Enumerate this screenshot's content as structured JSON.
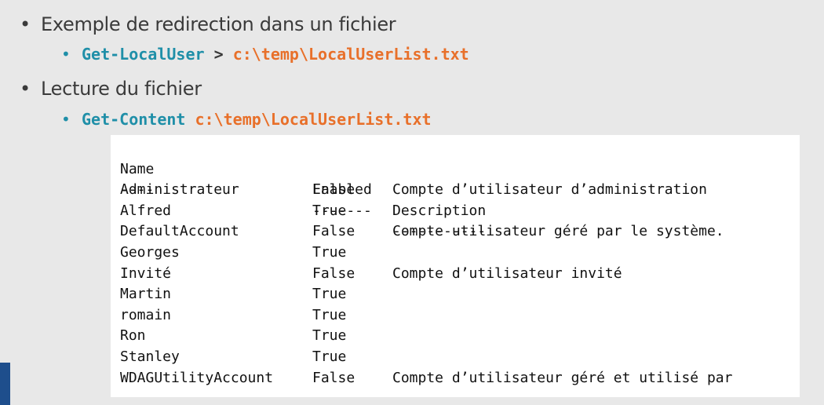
{
  "slide": {
    "bullet1": "Exemple de redirection dans un fichier",
    "cmd1": {
      "command": "Get-LocalUser",
      "operator": ">",
      "path": "c:\\temp\\LocalUserList.txt"
    },
    "bullet2": "Lecture du fichier",
    "cmd2": {
      "command": "Get-Content",
      "path": "c:\\temp\\LocalUserList.txt"
    }
  },
  "console": {
    "headers": [
      "Name",
      "Enabled",
      "Description"
    ],
    "separators": [
      "----",
      "-------",
      "-----------"
    ],
    "rows": [
      {
        "name": "Administrateur",
        "enabled": "False",
        "description": "Compte d’utilisateur d’administration"
      },
      {
        "name": "Alfred",
        "enabled": "True",
        "description": ""
      },
      {
        "name": "DefaultAccount",
        "enabled": "False",
        "description": "Compte utilisateur géré par le système."
      },
      {
        "name": "Georges",
        "enabled": "True",
        "description": ""
      },
      {
        "name": "Invité",
        "enabled": "False",
        "description": "Compte d’utilisateur invité"
      },
      {
        "name": "Martin",
        "enabled": "True",
        "description": ""
      },
      {
        "name": "romain",
        "enabled": "True",
        "description": ""
      },
      {
        "name": "Ron",
        "enabled": "True",
        "description": ""
      },
      {
        "name": "Stanley",
        "enabled": "True",
        "description": ""
      },
      {
        "name": "WDAGUtilityAccount",
        "enabled": "False",
        "description": "Compte d’utilisateur géré et utilisé par"
      }
    ]
  },
  "colors": {
    "command": "#1f8fa8",
    "path": "#e8702a",
    "accent": "#1e4e8c"
  }
}
